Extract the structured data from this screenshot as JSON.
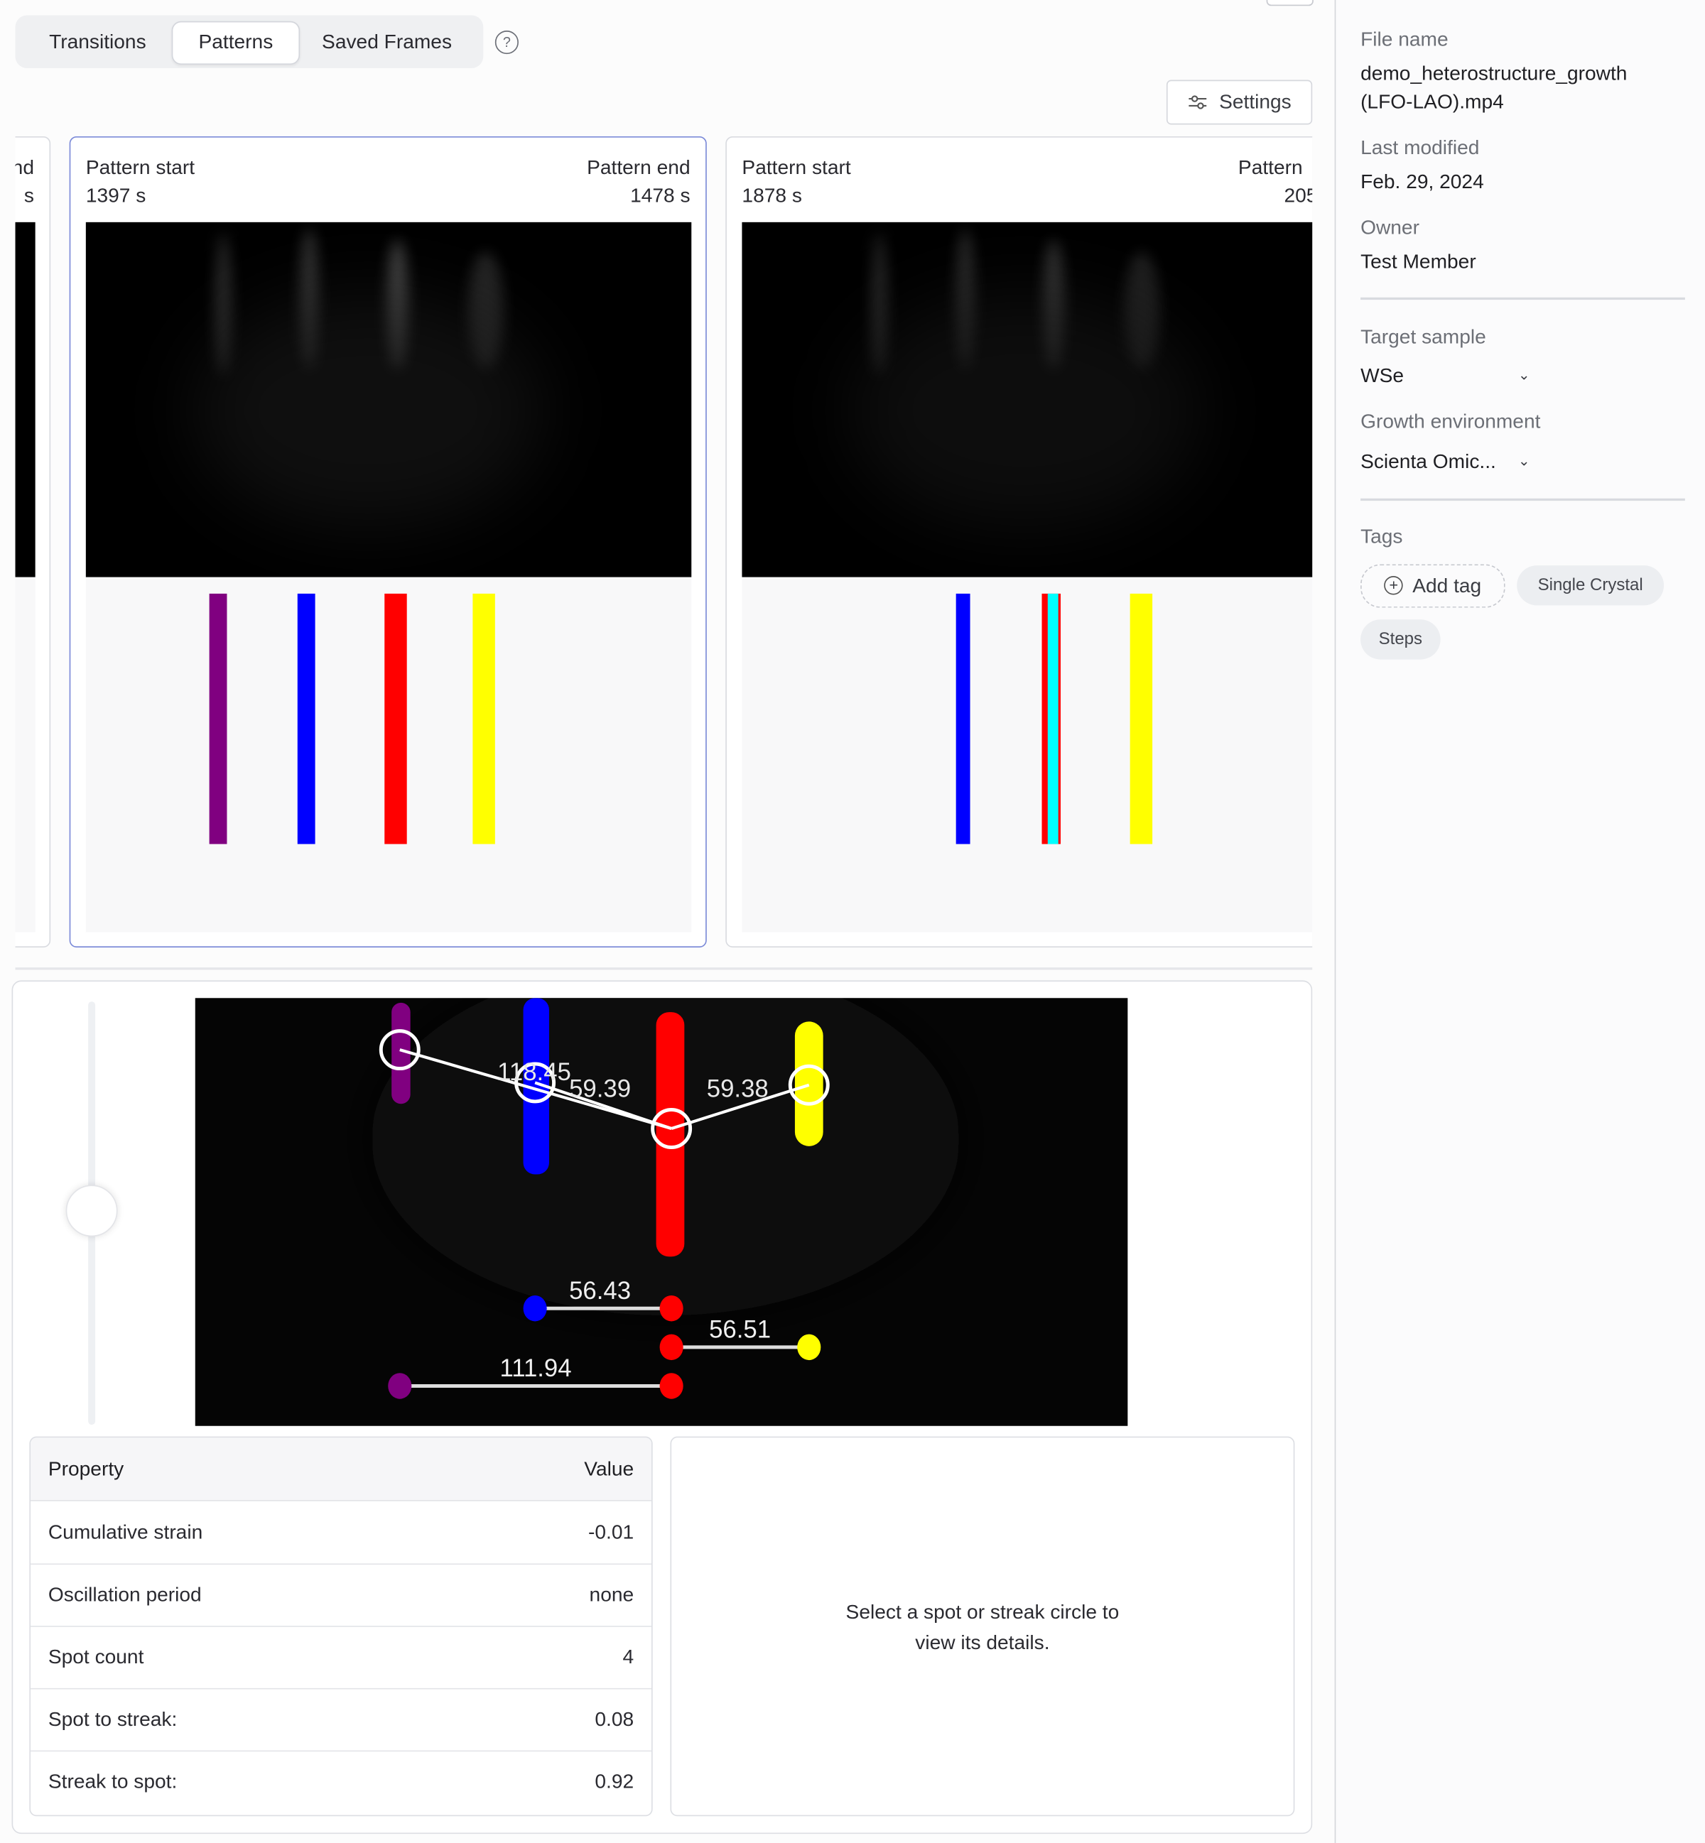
{
  "tabs": [
    {
      "label": "Transitions",
      "active": false
    },
    {
      "label": "Patterns",
      "active": true
    },
    {
      "label": "Saved Frames",
      "active": false
    }
  ],
  "help_icon": "question-circle-icon",
  "settings_button": {
    "label": "Settings",
    "icon": "sliders-icon"
  },
  "pattern_cards": [
    {
      "start_label": "nd",
      "start_value": "s",
      "partial": true,
      "stripes": []
    },
    {
      "start_label": "Pattern start",
      "start_value": "1397 s",
      "end_label": "Pattern end",
      "end_value": "1478 s",
      "selected": true,
      "stripes": [
        {
          "color": "#800080"
        },
        {
          "color": "#0000ff"
        },
        {
          "color": "#ff0000"
        },
        {
          "color": "#ffff00"
        }
      ]
    },
    {
      "start_label": "Pattern start",
      "start_value": "1878 s",
      "end_label": "Pattern",
      "end_value": "205",
      "selected": false,
      "stripes": [
        {
          "color": "#0000ff"
        },
        {
          "color": "#ff0000"
        },
        {
          "color": "#00ffff"
        },
        {
          "color": "#ffff00"
        }
      ]
    }
  ],
  "analysis": {
    "slider_value_fraction": 0.5,
    "spots": [
      {
        "name": "purple",
        "color": "#800080"
      },
      {
        "name": "blue",
        "color": "#0000ff"
      },
      {
        "name": "red",
        "color": "#ff0000"
      },
      {
        "name": "yellow",
        "color": "#ffff00"
      }
    ],
    "spot_distance_labels": [
      "118.45",
      "59.39",
      "59.38"
    ],
    "streak_distance_labels": [
      "56.43",
      "56.51",
      "111.94"
    ]
  },
  "properties_table": {
    "headers": {
      "property": "Property",
      "value": "Value"
    },
    "rows": [
      {
        "property": "Cumulative strain",
        "value": "-0.01"
      },
      {
        "property": "Oscillation period",
        "value": "none"
      },
      {
        "property": "Spot count",
        "value": "4"
      },
      {
        "property": "Spot to streak:",
        "value": "0.08"
      },
      {
        "property": "Streak to spot:",
        "value": "0.92"
      }
    ]
  },
  "detail_panel": {
    "placeholder": "Select a spot or streak circle to view its details."
  },
  "sidebar": {
    "file_name_label": "File name",
    "file_name_line1": "demo_heterostructure_growth",
    "file_name_line2": "(LFO-LAO).mp4",
    "last_modified_label": "Last modified",
    "last_modified": "Feb. 29, 2024",
    "owner_label": "Owner",
    "owner": "Test Member",
    "target_sample_label": "Target sample",
    "target_sample": "WSe",
    "growth_env_label": "Growth environment",
    "growth_env": "Scienta Omic...",
    "tags_label": "Tags",
    "add_tag_label": "Add tag",
    "tags": [
      "Single Crystal",
      "Steps"
    ]
  }
}
